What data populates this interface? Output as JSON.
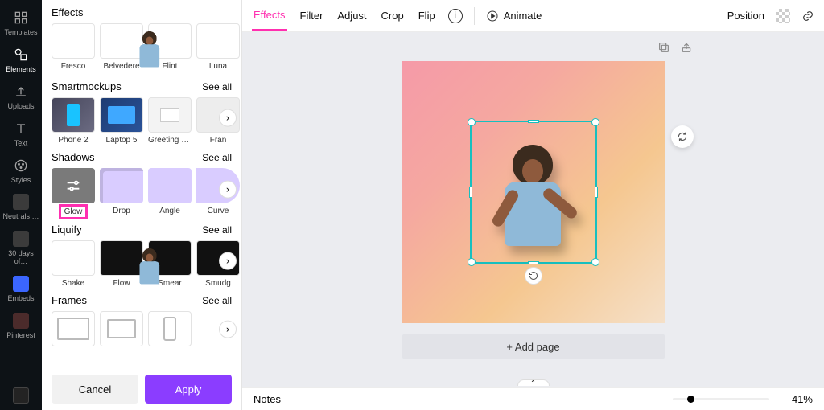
{
  "rail": {
    "items": [
      {
        "label": "Templates"
      },
      {
        "label": "Elements"
      },
      {
        "label": "Uploads"
      },
      {
        "label": "Text"
      },
      {
        "label": "Styles"
      },
      {
        "label": "Neutrals …"
      },
      {
        "label": "30 days of…"
      },
      {
        "label": "Embeds"
      },
      {
        "label": "Pinterest"
      }
    ]
  },
  "panel": {
    "title": "Effects",
    "first_row": {
      "items": [
        "Fresco",
        "Belvedere",
        "Flint",
        "Luna"
      ]
    },
    "sections": [
      {
        "title": "Smartmockups",
        "see_all": "See all",
        "items": [
          {
            "l": "Phone 2"
          },
          {
            "l": "Laptop 5"
          },
          {
            "l": "Greeting car…"
          },
          {
            "l": "Fran"
          }
        ]
      },
      {
        "title": "Shadows",
        "see_all": "See all",
        "items": [
          {
            "l": "Glow",
            "sel": true
          },
          {
            "l": "Drop"
          },
          {
            "l": "Angle"
          },
          {
            "l": "Curve"
          }
        ]
      },
      {
        "title": "Liquify",
        "see_all": "See all",
        "items": [
          {
            "l": "Shake"
          },
          {
            "l": "Flow"
          },
          {
            "l": "Smear"
          },
          {
            "l": "Smudg"
          }
        ]
      },
      {
        "title": "Frames",
        "see_all": "See all",
        "items": [
          {
            "l": ""
          },
          {
            "l": ""
          },
          {
            "l": ""
          }
        ]
      }
    ],
    "footer": {
      "cancel": "Cancel",
      "apply": "Apply"
    }
  },
  "topbar": {
    "tabs": [
      "Effects",
      "Filter",
      "Adjust",
      "Crop",
      "Flip"
    ],
    "animate": "Animate",
    "position": "Position"
  },
  "canvas": {
    "add_page": "+ Add page"
  },
  "bottombar": {
    "notes": "Notes",
    "zoom": "41%"
  }
}
